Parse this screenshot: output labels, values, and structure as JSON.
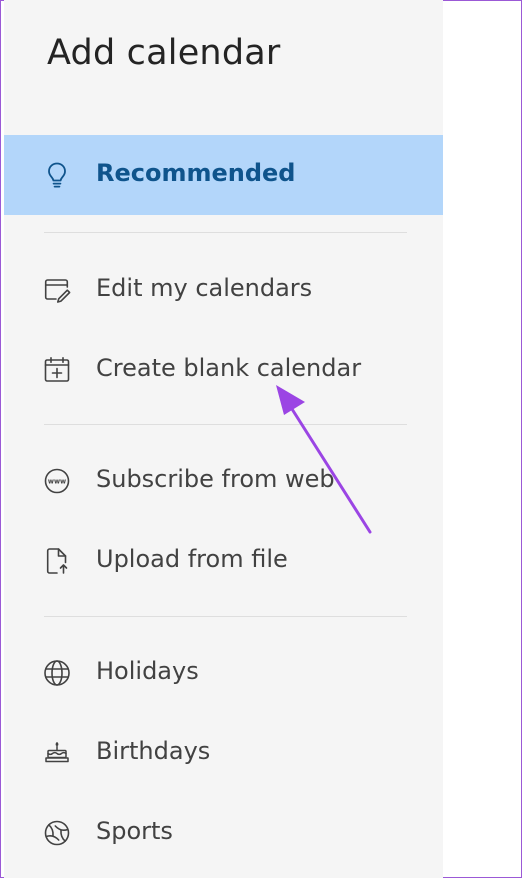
{
  "dialog": {
    "title": "Add calendar"
  },
  "nav": {
    "recommended": {
      "label": "Recommended",
      "icon": "lightbulb-icon"
    },
    "edit_my_calendars": {
      "label": "Edit my calendars",
      "icon": "edit-calendar-icon"
    },
    "create_blank_calendar": {
      "label": "Create blank calendar",
      "icon": "calendar-add-icon"
    },
    "subscribe_from_web": {
      "label": "Subscribe from web",
      "icon": "web-icon"
    },
    "upload_from_file": {
      "label": "Upload from file",
      "icon": "file-upload-icon"
    },
    "holidays": {
      "label": "Holidays",
      "icon": "globe-icon"
    },
    "birthdays": {
      "label": "Birthdays",
      "icon": "birthday-cake-icon"
    },
    "sports": {
      "label": "Sports",
      "icon": "sports-ball-icon"
    }
  },
  "colors": {
    "selected_bg": "#b3d6fa",
    "selected_text": "#0f548c",
    "panel_bg": "#f5f5f5",
    "annotation_arrow": "#9b45e4"
  }
}
